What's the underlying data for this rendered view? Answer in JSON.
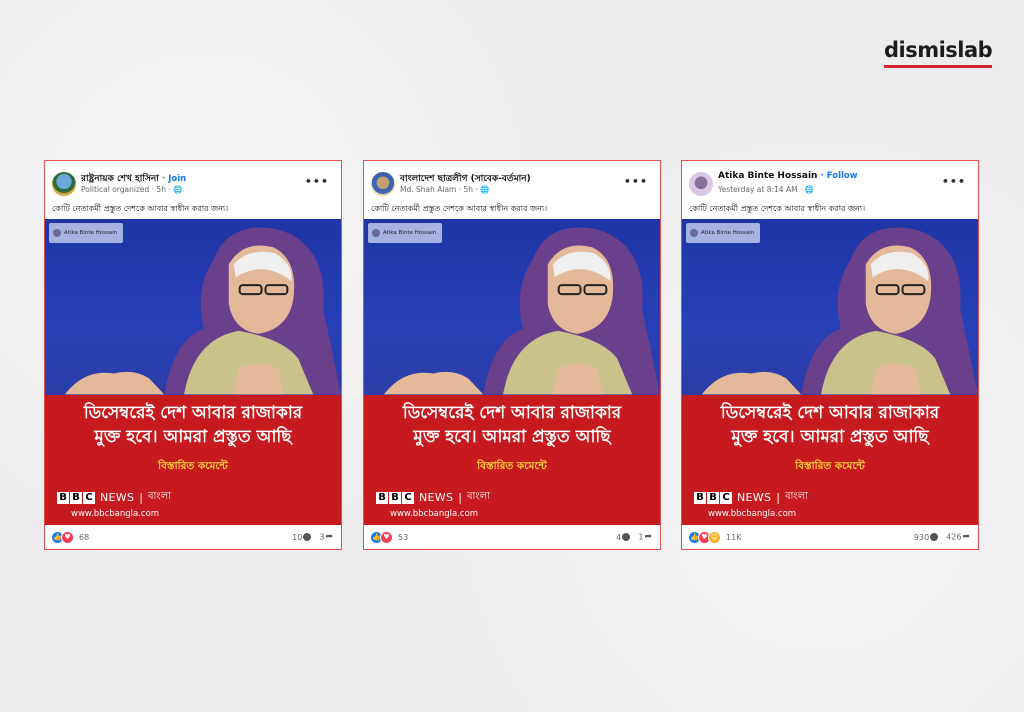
{
  "brand": {
    "name": "dismislab",
    "accent": "#d32630"
  },
  "posts": [
    {
      "title": "রাষ্ট্রনায়ক শেখ হাসিনা",
      "action": "Join",
      "subtitle": "Political organized · 5h · ",
      "caption": "কোটি নেতাকর্মী প্রস্তুত দেশকে আবার স্বাধীন করার জন্য।",
      "watermark": "Atika Binte Hossain",
      "headline_line1": "ডিসেম্বরেই দেশ আবার রাজাকার",
      "headline_line2": "মুক্ত হবে। আমরা প্রস্তুত আছি",
      "subheadline": "বিস্তারিত কমেন্টে",
      "bbc_news": "NEWS",
      "bbc_lang": "বাংলা",
      "url": "www.bbcbangla.com",
      "reactions": "68",
      "comments": "10",
      "shares": "3"
    },
    {
      "title": "বাংলাদেশ ছাত্রলীগ (সাবেক-বর্তমান)",
      "action": "",
      "subtitle": "Md. Shah Alam · 5h · ",
      "caption": "কোটি নেতাকর্মী প্রস্তুত দেশকে আবার স্বাধীন করার জন্য।",
      "watermark": "Atika Binte Hossain",
      "headline_line1": "ডিসেম্বরেই দেশ আবার রাজাকার",
      "headline_line2": "মুক্ত হবে। আমরা প্রস্তুত আছি",
      "subheadline": "বিস্তারিত কমেন্টে",
      "bbc_news": "NEWS",
      "bbc_lang": "বাংলা",
      "url": "www.bbcbangla.com",
      "reactions": "53",
      "comments": "4",
      "shares": "1"
    },
    {
      "title": "Atika Binte Hossain",
      "action": "Follow",
      "subtitle": "Yesterday at 8:14 AM · ",
      "caption": "কোটি নেতাকর্মী প্রস্তুত দেশকে আবার স্বাধীন করার জন্য।",
      "watermark": "Atika Binte Hossain",
      "headline_line1": "ডিসেম্বরেই দেশ আবার রাজাকার",
      "headline_line2": "মুক্ত হবে। আমরা প্রস্তুত আছি",
      "subheadline": "বিস্তারিত কমেন্টে",
      "bbc_news": "NEWS",
      "bbc_lang": "বাংলা",
      "url": "www.bbcbangla.com",
      "reactions": "11K",
      "comments": "930",
      "shares": "426"
    }
  ],
  "colors": {
    "card_border": "#e0514f",
    "banner_red": "#c71a1e",
    "photo_blue": "#2840b6",
    "link_blue": "#1877f2",
    "subheadline_yellow": "#ffd23a"
  }
}
